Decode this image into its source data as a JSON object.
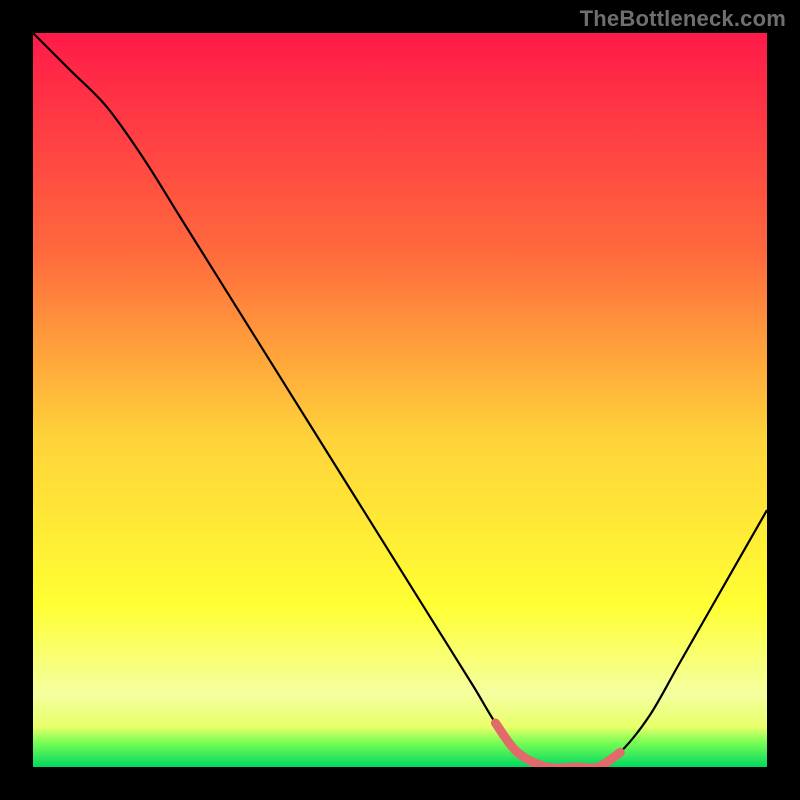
{
  "attribution": "TheBottleneck.com",
  "chart_data": {
    "type": "line",
    "title": "",
    "xlabel": "",
    "ylabel": "",
    "xlim": [
      0,
      100
    ],
    "ylim": [
      0,
      100
    ],
    "x": [
      0,
      5,
      10,
      15,
      20,
      25,
      30,
      35,
      40,
      45,
      50,
      55,
      60,
      63,
      66,
      70,
      74,
      77,
      80,
      84,
      88,
      92,
      96,
      100
    ],
    "values": [
      100,
      95,
      90,
      83,
      75,
      67,
      59,
      51,
      43,
      35,
      27,
      19,
      11,
      6,
      2,
      0,
      0,
      0,
      2,
      7,
      14,
      21,
      28,
      35
    ],
    "highlight_range": {
      "x_start": 63,
      "x_end": 80,
      "color": "#e26a6a"
    },
    "gradient_stops": [
      {
        "offset": 0.0,
        "color": "#ff1a49"
      },
      {
        "offset": 0.3,
        "color": "#ff6a3d"
      },
      {
        "offset": 0.55,
        "color": "#ffd23a"
      },
      {
        "offset": 0.78,
        "color": "#ffff33"
      },
      {
        "offset": 0.9,
        "color": "#f4ffa0"
      },
      {
        "offset": 0.945,
        "color": "#e9ff6a"
      },
      {
        "offset": 0.965,
        "color": "#7fff55"
      },
      {
        "offset": 1.0,
        "color": "#00d860"
      }
    ]
  }
}
